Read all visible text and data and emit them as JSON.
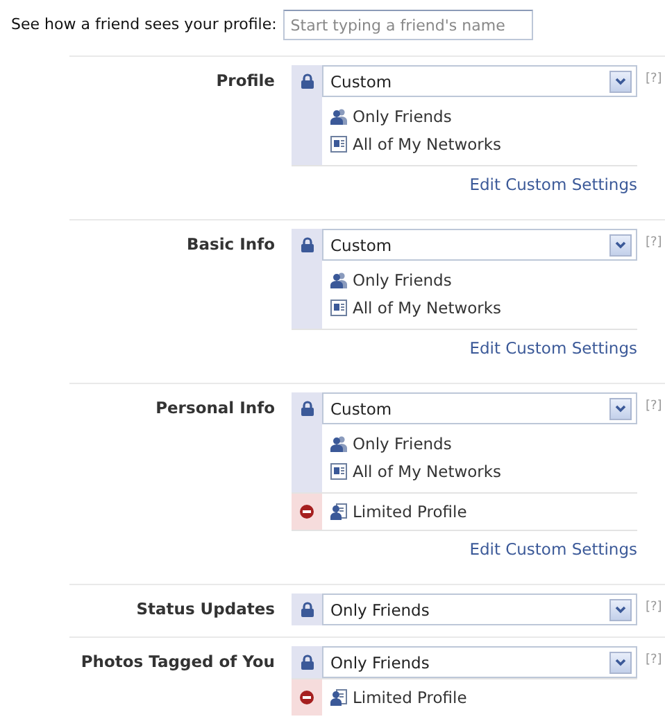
{
  "preview": {
    "label": "See how a friend sees your profile:",
    "placeholder": "Start typing a friend's name"
  },
  "sections": [
    {
      "label": "Profile",
      "selection": "Custom",
      "help": "[?]",
      "allow": [
        {
          "kind": "friends",
          "text": "Only Friends"
        },
        {
          "kind": "network",
          "text": "All of My Networks"
        }
      ],
      "link": "Edit Custom Settings"
    },
    {
      "label": "Basic Info",
      "selection": "Custom",
      "help": "[?]",
      "allow": [
        {
          "kind": "friends",
          "text": "Only Friends"
        },
        {
          "kind": "network",
          "text": "All of My Networks"
        }
      ],
      "link": "Edit Custom Settings"
    },
    {
      "label": "Personal Info",
      "selection": "Custom",
      "help": "[?]",
      "allow": [
        {
          "kind": "friends",
          "text": "Only Friends"
        },
        {
          "kind": "network",
          "text": "All of My Networks"
        }
      ],
      "deny": [
        {
          "kind": "limited",
          "text": "Limited Profile"
        }
      ],
      "link": "Edit Custom Settings"
    },
    {
      "label": "Status Updates",
      "selection": "Only Friends",
      "help": "[?]"
    },
    {
      "label": "Photos Tagged of You",
      "selection": "Only Friends",
      "help": "[?]",
      "deny": [
        {
          "kind": "limited",
          "text": "Limited Profile"
        }
      ]
    }
  ]
}
